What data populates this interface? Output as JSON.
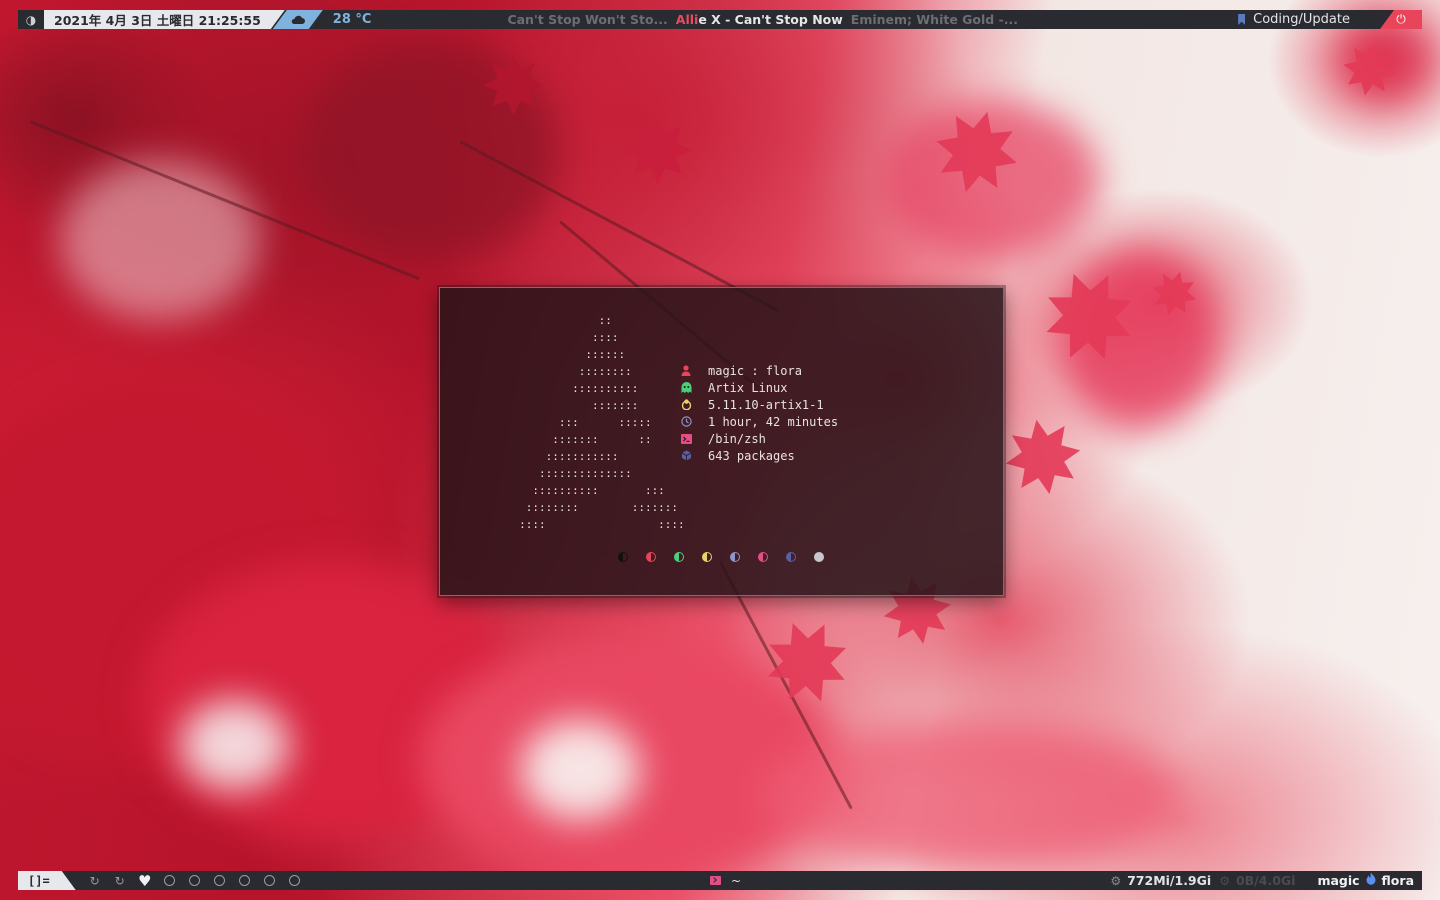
{
  "theme": {
    "bar_bg": "#2a2b31",
    "accent_red": "#e8455a",
    "accent_blue": "#7fb2dc",
    "bookmark_blue": "#5b7ac0",
    "fetch_bg": "#261418"
  },
  "topbar": {
    "theme_icon": "half-moon-icon",
    "date": "2021年 4月 3日 土曜日 21:25:55",
    "weather_icon": "cloud-icon",
    "temperature": "28 °C",
    "songs": {
      "previous": "Can't Stop Won't Sto...",
      "current_highlight": "Alli",
      "current_rest": "e X - Can't Stop Now",
      "next": "Eminem; White Gold -..."
    },
    "bookmark_icon": "bookmark-icon",
    "bookmark_label": "Coding/Update",
    "power_icon": "power-icon"
  },
  "bottombar": {
    "layout_symbol": "[]=",
    "workspaces": [
      {
        "icon": "refresh-icon",
        "glyph": "↻",
        "active": false
      },
      {
        "icon": "refresh-icon",
        "glyph": "↻",
        "active": false
      },
      {
        "icon": "heart-icon",
        "glyph": "♥",
        "active": true
      },
      {
        "icon": "circle-icon",
        "active": false
      },
      {
        "icon": "circle-icon",
        "active": false
      },
      {
        "icon": "circle-icon",
        "active": false
      },
      {
        "icon": "circle-icon",
        "active": false
      },
      {
        "icon": "circle-icon",
        "active": false
      },
      {
        "icon": "circle-icon",
        "active": false
      }
    ],
    "terminal_icon": "terminal-icon",
    "terminal_title": "~",
    "memory": "772Mi/1.9Gi",
    "swap": "0B/4.0Gi",
    "user": "magic",
    "flame_icon": "flame-icon",
    "host": "flora"
  },
  "fetch": {
    "ascii": "                 ::\n                ::::\n               ::::::\n              ::::::::\n             ::::::::::\n                :::::::\n           :::      :::::\n          :::::::      ::\n         :::::::::::\n        ::::::::::::::\n       ::::::::::       :::\n      ::::::::        :::::::\n     ::::                 ::::",
    "rows": [
      {
        "icon": "user-icon",
        "color": "#e8455a",
        "value": "magic : flora"
      },
      {
        "icon": "ghost-icon",
        "color": "#4bd07a",
        "value": "Artix Linux"
      },
      {
        "icon": "tux-icon",
        "color": "#e5d46a",
        "value": "5.11.10-artix1-1"
      },
      {
        "icon": "clock-icon",
        "color": "#8f95c8",
        "value": "1 hour, 42 minutes"
      },
      {
        "icon": "terminal-icon",
        "color": "#e24f86",
        "value": "/bin/zsh"
      },
      {
        "icon": "package-icon",
        "color": "#5a5fa8",
        "value": "643 packages"
      }
    ],
    "palette": [
      "#1b1b1f",
      "#e8455a",
      "#4bd07a",
      "#e5d46a",
      "#8f95c8",
      "#e24f86",
      "#5a5fa8",
      "#c8c8cc"
    ]
  }
}
